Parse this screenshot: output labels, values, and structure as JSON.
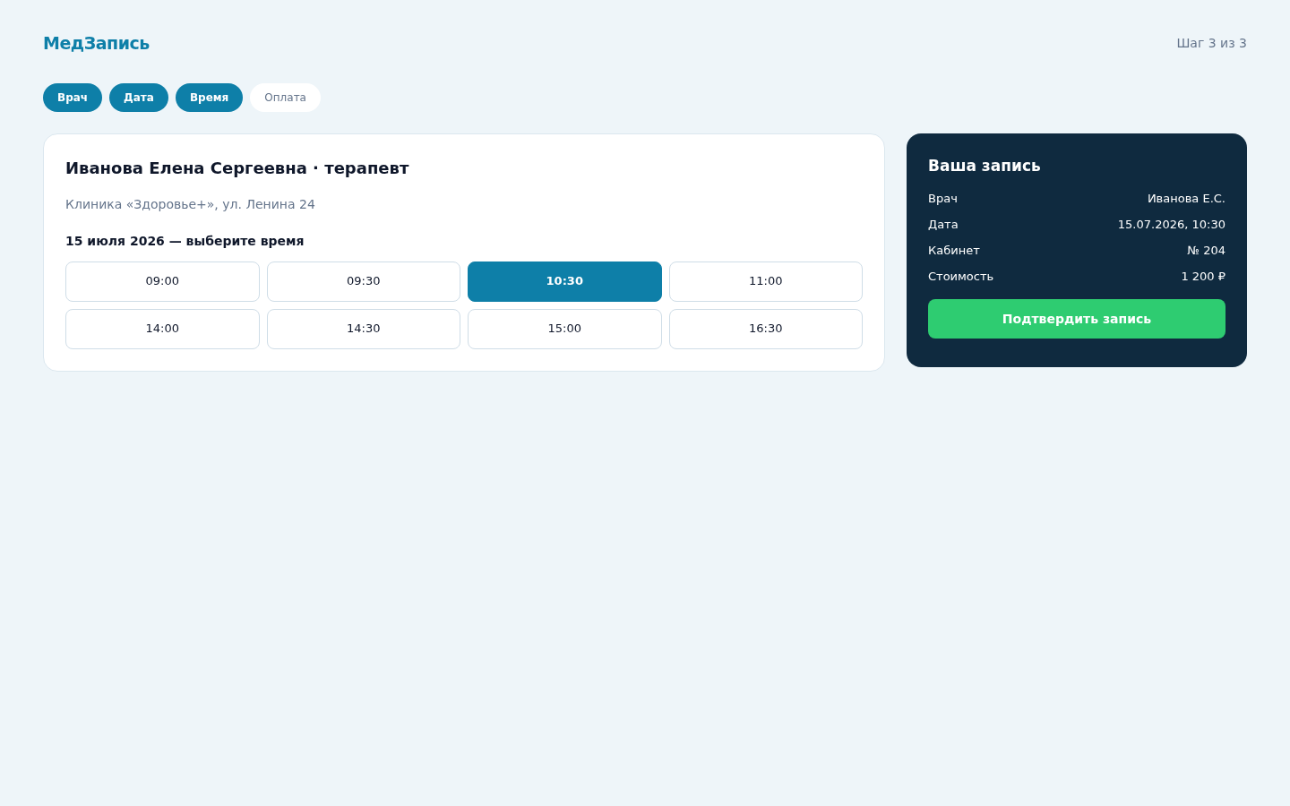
{
  "header": {
    "logo": "МедЗапись",
    "step_indicator": "Шаг 3 из 3"
  },
  "steps": [
    {
      "label": "Врач",
      "done": true
    },
    {
      "label": "Дата",
      "done": true
    },
    {
      "label": "Время",
      "done": true
    },
    {
      "label": "Оплата",
      "done": false
    }
  ],
  "doctor_card": {
    "title": "Иванова Елена Сергеевна · терапевт",
    "clinic": "Клиника «Здоровье+», ул. Ленина 24",
    "prompt": "15 июля 2026 — выберите время",
    "slots": [
      {
        "label": "09:00",
        "selected": false
      },
      {
        "label": "09:30",
        "selected": false
      },
      {
        "label": "10:30",
        "selected": true
      },
      {
        "label": "11:00",
        "selected": false
      },
      {
        "label": "14:00",
        "selected": false
      },
      {
        "label": "14:30",
        "selected": false
      },
      {
        "label": "15:00",
        "selected": false
      },
      {
        "label": "16:30",
        "selected": false
      }
    ]
  },
  "summary": {
    "title": "Ваша запись",
    "rows": [
      {
        "label": "Врач",
        "value": "Иванова Е.С."
      },
      {
        "label": "Дата",
        "value": "15.07.2026, 10:30"
      },
      {
        "label": "Кабинет",
        "value": "№ 204"
      },
      {
        "label": "Стоимость",
        "value": "1 200 ₽"
      }
    ],
    "button": "Подтвердить запись"
  }
}
